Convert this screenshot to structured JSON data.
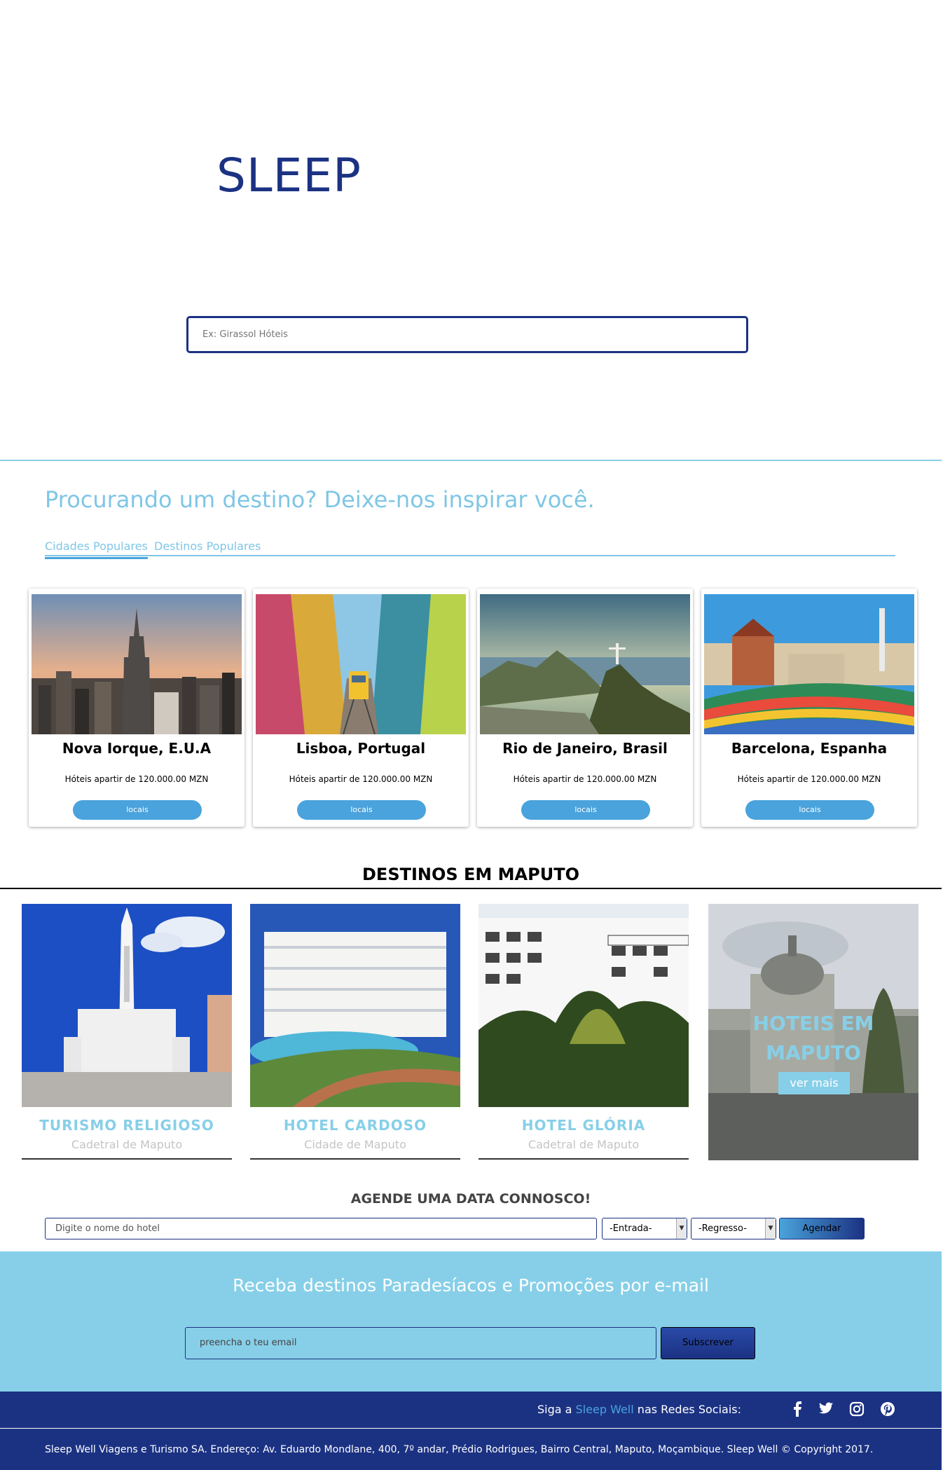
{
  "brand": {
    "logo": "SLEEP"
  },
  "search": {
    "placeholder": "Ex: Girassol Hóteis"
  },
  "inspire": {
    "heading": "Procurando um destino? Deixe-nos inspirar você.",
    "tabs": [
      "Cidades Populares",
      "Destinos Populares"
    ]
  },
  "cities": [
    {
      "name": "Nova Iorque, E.U.A",
      "price": "Hóteis apartir de 120.000.00 MZN",
      "button": "locais"
    },
    {
      "name": "Lisboa, Portugal",
      "price": "Hóteis apartir de 120.000.00 MZN",
      "button": "locais"
    },
    {
      "name": "Rio de Janeiro, Brasil",
      "price": "Hóteis apartir de 120.000.00 MZN",
      "button": "locais"
    },
    {
      "name": "Barcelona, Espanha",
      "price": "Hóteis apartir de 120.000.00 MZN",
      "button": "locais"
    }
  ],
  "maputo": {
    "title": "DESTINOS EM MAPUTO",
    "items": [
      {
        "title": "TURISMO RELIGIOSO",
        "subtitle": "Cadetral de Maputo"
      },
      {
        "title": "HOTEL CARDOSO",
        "subtitle": "Cidade de Maputo"
      },
      {
        "title": "HOTEL GLÓRIA",
        "subtitle": "Cadetral de Maputo"
      }
    ],
    "feature": {
      "title": "HOTEIS EM MAPUTO",
      "button": "ver mais"
    }
  },
  "booking": {
    "title": "AGENDE UMA DATA CONNOSCO!",
    "hotel_placeholder": "Digite o nome do hotel",
    "entrada": "-Entrada-",
    "regresso": "-Regresso-",
    "button": "Agendar"
  },
  "newsletter": {
    "heading": "Receba destinos Paradesíacos e Promoções por e-mail",
    "email_placeholder": "preencha o teu email",
    "button": "Subscrever"
  },
  "social": {
    "prefix": "Siga a",
    "brand": "Sleep Well",
    "suffix": "nas Redes Sociais:",
    "icons": [
      "facebook-icon",
      "twitter-icon",
      "instagram-icon",
      "pinterest-icon"
    ]
  },
  "footer": {
    "copyright": "Sleep Well Viagens e Turismo SA. Endereço: Av. Eduardo Mondlane, 400, 7º andar, Prédio Rodrigues, Bairro Central, Maputo, Moçambique. Sleep Well © Copyright 2017."
  },
  "colors": {
    "navy": "#1b3283",
    "sky": "#87cfe8",
    "blue": "#4aa3dc"
  }
}
